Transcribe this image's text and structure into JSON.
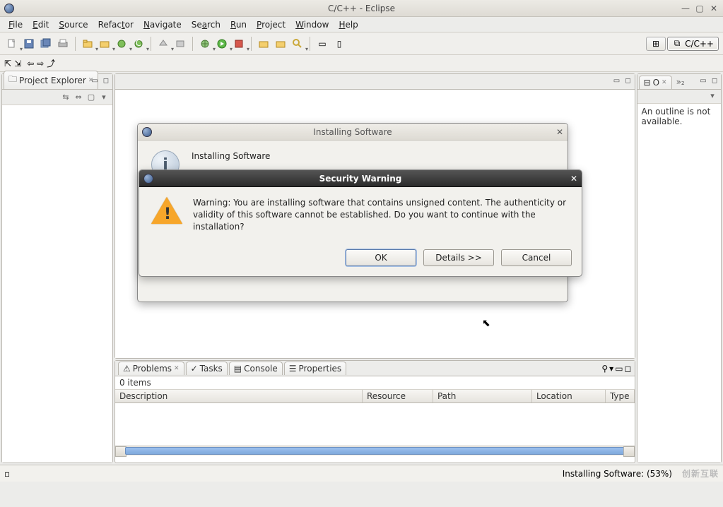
{
  "window": {
    "title": "C/C++ - Eclipse"
  },
  "menu": {
    "file": "File",
    "edit": "Edit",
    "source": "Source",
    "refactor": "Refactor",
    "navigate": "Navigate",
    "search": "Search",
    "run": "Run",
    "project": "Project",
    "window": "Window",
    "help": "Help"
  },
  "perspective": {
    "label": "C/C++"
  },
  "views": {
    "project_explorer": "Project Explorer",
    "outline_short": "O",
    "outline_msg": "An outline is not available.",
    "problems": "Problems",
    "tasks": "Tasks",
    "console": "Console",
    "properties": "Properties",
    "items_count": "0 items",
    "col_desc": "Description",
    "col_res": "Resource",
    "col_path": "Path",
    "col_loc": "Location",
    "col_type": "Type"
  },
  "install_dialog": {
    "title": "Installing Software",
    "heading": "Installing Software"
  },
  "security_dialog": {
    "title": "Security Warning",
    "message": "Warning: You are installing software that contains unsigned content. The authenticity or validity of this software cannot be established. Do you want to continue with the installation?",
    "ok": "OK",
    "details": "Details >>",
    "cancel": "Cancel"
  },
  "status": {
    "progress": "Installing Software: (53%)"
  },
  "watermark": "创新互联"
}
